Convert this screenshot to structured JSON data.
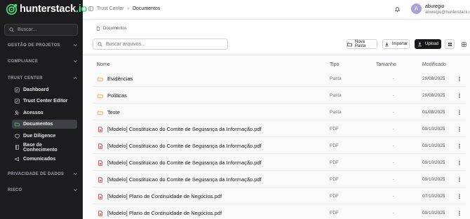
{
  "brand": {
    "name": "hunterstack",
    "suffix": ".io"
  },
  "sidebar": {
    "search_placeholder": "Buscar...",
    "sections": [
      {
        "label": "GESTÃO DE PROJETOS",
        "expanded": false
      },
      {
        "label": "COMPLIANCE",
        "expanded": false
      },
      {
        "label": "TRUST CENTER",
        "expanded": true
      },
      {
        "label": "PRIVACIDADE DE DADOS",
        "expanded": false
      },
      {
        "label": "RISCO",
        "expanded": false
      }
    ],
    "trust_items": [
      {
        "label": "Dashboard",
        "icon": "dashboard-icon",
        "active": false
      },
      {
        "label": "Trust Center Editor",
        "icon": "edit-icon",
        "active": false
      },
      {
        "label": "Acessos",
        "icon": "user-key-icon",
        "active": false
      },
      {
        "label": "Documentos",
        "icon": "folder-icon",
        "active": true
      },
      {
        "label": "Due Diligence",
        "icon": "shield-icon",
        "active": false
      },
      {
        "label": "Base de Conhecimento",
        "icon": "book-icon",
        "active": false
      },
      {
        "label": "Comunicados",
        "icon": "megaphone-icon",
        "active": false
      }
    ]
  },
  "header": {
    "breadcrumb": [
      "Trust Center",
      "Documentos"
    ],
    "user": {
      "initial": "A",
      "name": "aburegio",
      "email": "aburegio@hunterstack.io"
    }
  },
  "page": {
    "breadcrumb": "Documentos",
    "search_placeholder": "Buscar arquivos...",
    "buttons": {
      "new_folder": "Nova Pasta",
      "import": "Importar",
      "upload": "Upload"
    }
  },
  "table": {
    "columns": {
      "name": "Nome",
      "type": "Tipo",
      "size": "Tamanho",
      "modified": "Modificado"
    },
    "rows": [
      {
        "name": "Evidências",
        "kind": "folder",
        "type": "Pasta",
        "size": "-",
        "modified": "29/08/2025"
      },
      {
        "name": "Politicas",
        "kind": "folder",
        "type": "Pasta",
        "size": "-",
        "modified": "29/08/2025"
      },
      {
        "name": "Teste",
        "kind": "folder",
        "type": "Pasta",
        "size": "-",
        "modified": "01/08/2025"
      },
      {
        "name": "[Modelo] Constituicao do Comite de Segurança da Informação.pdf",
        "kind": "pdf",
        "type": "PDF",
        "size": "-",
        "modified": "09/10/2025"
      },
      {
        "name": "[Modelo] Constituicao do Comite de Segurança da Informação.pdf",
        "kind": "pdf",
        "type": "PDF",
        "size": "-",
        "modified": "09/10/2025"
      },
      {
        "name": "[Modelo] Constituicao do Comite de Segurança da Informação.pdf",
        "kind": "pdf",
        "type": "PDF",
        "size": "-",
        "modified": "09/10/2025"
      },
      {
        "name": "[Modelo] Constituicao do Comite de Segurança da Informação.pdf",
        "kind": "pdf",
        "type": "PDF",
        "size": "-",
        "modified": "09/10/2025"
      },
      {
        "name": "[Modelo] Plano de Continuidade de Negócios.pdf",
        "kind": "pdf",
        "type": "PDF",
        "size": "-",
        "modified": "07/10/2025"
      },
      {
        "name": "[Modelo] Plano de Continuidade de Negócios.pdf",
        "kind": "pdf",
        "type": "PDF",
        "size": "-",
        "modified": "09/10/2025"
      }
    ]
  },
  "colors": {
    "accent": "#4ade80",
    "folder": "#e9a23b",
    "pdf": "#dc2626",
    "sidebar_bg": "#1c1c1f"
  }
}
